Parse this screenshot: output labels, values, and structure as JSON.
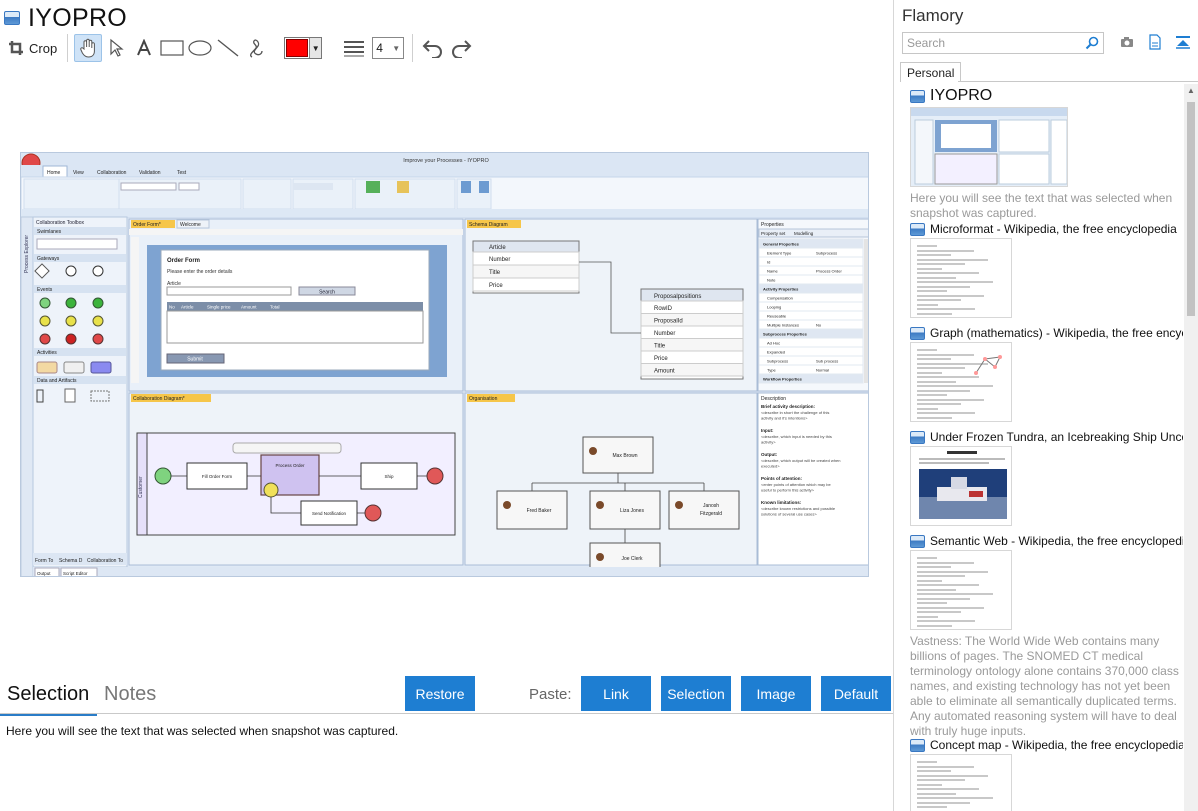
{
  "window": {
    "title": "IYOPRO"
  },
  "toolbar": {
    "crop_label": "Crop",
    "line_width_value": "4",
    "stroke_color": "#ff0000",
    "tools": [
      "hand-icon",
      "pointer-icon",
      "text-icon",
      "rectangle-icon",
      "ellipse-icon",
      "line-icon",
      "freehand-icon"
    ]
  },
  "snapshot": {
    "app_title": "Improve your Processes - IYOPRO",
    "ribbon_tabs": [
      "Home",
      "View",
      "Collaboration",
      "Validation",
      "Test"
    ],
    "toolbox_title": "Collaboration Toolbox",
    "toolbox_sections": [
      "Swimlanes",
      "Gateways",
      "Events",
      "Activities",
      "Data and Artifacts"
    ],
    "doc_tabs": [
      "Order Form*",
      "Welcome"
    ],
    "form": {
      "title": "Order Form",
      "subtitle": "Please enter the order details",
      "field_label": "Article",
      "search_label": "Search",
      "columns": [
        "No",
        "Article",
        "Single price",
        "Amount",
        "Total"
      ],
      "submit_label": "Submit"
    },
    "schema_tab": "Schema Diagram",
    "schema_article": {
      "name": "Article",
      "fields": [
        "Number",
        "Title",
        "Price"
      ]
    },
    "schema_positions": {
      "name": "Proposalpositions",
      "fields": [
        "RowID",
        "ProposalId",
        "Number",
        "Title",
        "Price",
        "Amount"
      ]
    },
    "collab_tab": "Collaboration Diagram*",
    "process_nodes": [
      "Fill Order Form",
      "Process Order",
      "Ship",
      "Send Notification"
    ],
    "lane_label": "Customer",
    "org_tab": "Organisation",
    "org_people": [
      "Max  Brown",
      "Fred Baker",
      "Liza Jones",
      "Janosh Fitzgerald",
      "Joe  Clerk"
    ],
    "properties_title": "Properties",
    "properties_tabs": [
      "Property set",
      "Modelling"
    ],
    "properties": [
      [
        "General Properties",
        ""
      ],
      [
        "Element Type",
        "Subprocess"
      ],
      [
        "Id",
        ""
      ],
      [
        "Name",
        "Process Order"
      ],
      [
        "Note",
        ""
      ],
      [
        "Activity Properties",
        ""
      ],
      [
        "Compensation",
        ""
      ],
      [
        "Looping",
        ""
      ],
      [
        "Reuseable",
        ""
      ],
      [
        "Multiple Instances",
        "No"
      ],
      [
        "Subprocess Properties",
        ""
      ],
      [
        "Ad Hoc",
        ""
      ],
      [
        "Expanded",
        ""
      ],
      [
        "Subprocess",
        "Sub process"
      ],
      [
        "Type",
        "Normal"
      ],
      [
        "Workflow Properties",
        ""
      ]
    ],
    "description_title": "Description",
    "description": [
      [
        "Brief activity description:",
        "<describe in short the challenge of this activity and it's intentions>"
      ],
      [
        "Input:",
        "<describe, which input is needed by this activity>"
      ],
      [
        "Output:",
        "<describe, which output will be created when executed>"
      ],
      [
        "Points of attention:",
        "<enter points of attention which may be useful to perform this activity>"
      ],
      [
        "Known limitations:",
        "<describe known restrictions and possible solutions of several use cases>"
      ]
    ],
    "bottom_tabs": [
      "Output",
      "Script Editor"
    ],
    "left_bottom_tabs": [
      "Form To",
      "Schema D",
      "Collaboration To"
    ]
  },
  "bottom": {
    "tabs": [
      "Selection",
      "Notes"
    ],
    "restore_label": "Restore",
    "paste_label": "Paste:",
    "paste_buttons": [
      "Link",
      "Selection",
      "Image",
      "Default"
    ],
    "selection_text": "Here you will see the text that was selected when snapshot was captured."
  },
  "side": {
    "app_name": "Flamory",
    "search_placeholder": "Search",
    "tab_personal": "Personal",
    "entries": [
      {
        "title": "IYOPRO",
        "text": "Here you will see the text that was selected when snapshot was captured."
      },
      {
        "title": "Microformat - Wikipedia, the free encyclopedia",
        "text": ""
      },
      {
        "title": "Graph (mathematics) - Wikipedia, the free encyclopedia",
        "text": ""
      },
      {
        "title": "Under Frozen Tundra, an Icebreaking Ship Uncovers",
        "text": ""
      },
      {
        "title": "Semantic Web - Wikipedia, the free encyclopedia",
        "text": "Vastness: The World Wide Web contains many billions of pages. The SNOMED CT medical terminology ontology alone contains 370,000 class names, and existing technology has not yet been able to eliminate all semantically duplicated terms. Any automated reasoning system will have to deal with truly huge inputs."
      },
      {
        "title": "Concept map - Wikipedia, the free encyclopedia",
        "text": ""
      }
    ]
  },
  "colors": {
    "accent": "#1e7ed2",
    "selection_tab_underline": "#2a7cc7"
  }
}
